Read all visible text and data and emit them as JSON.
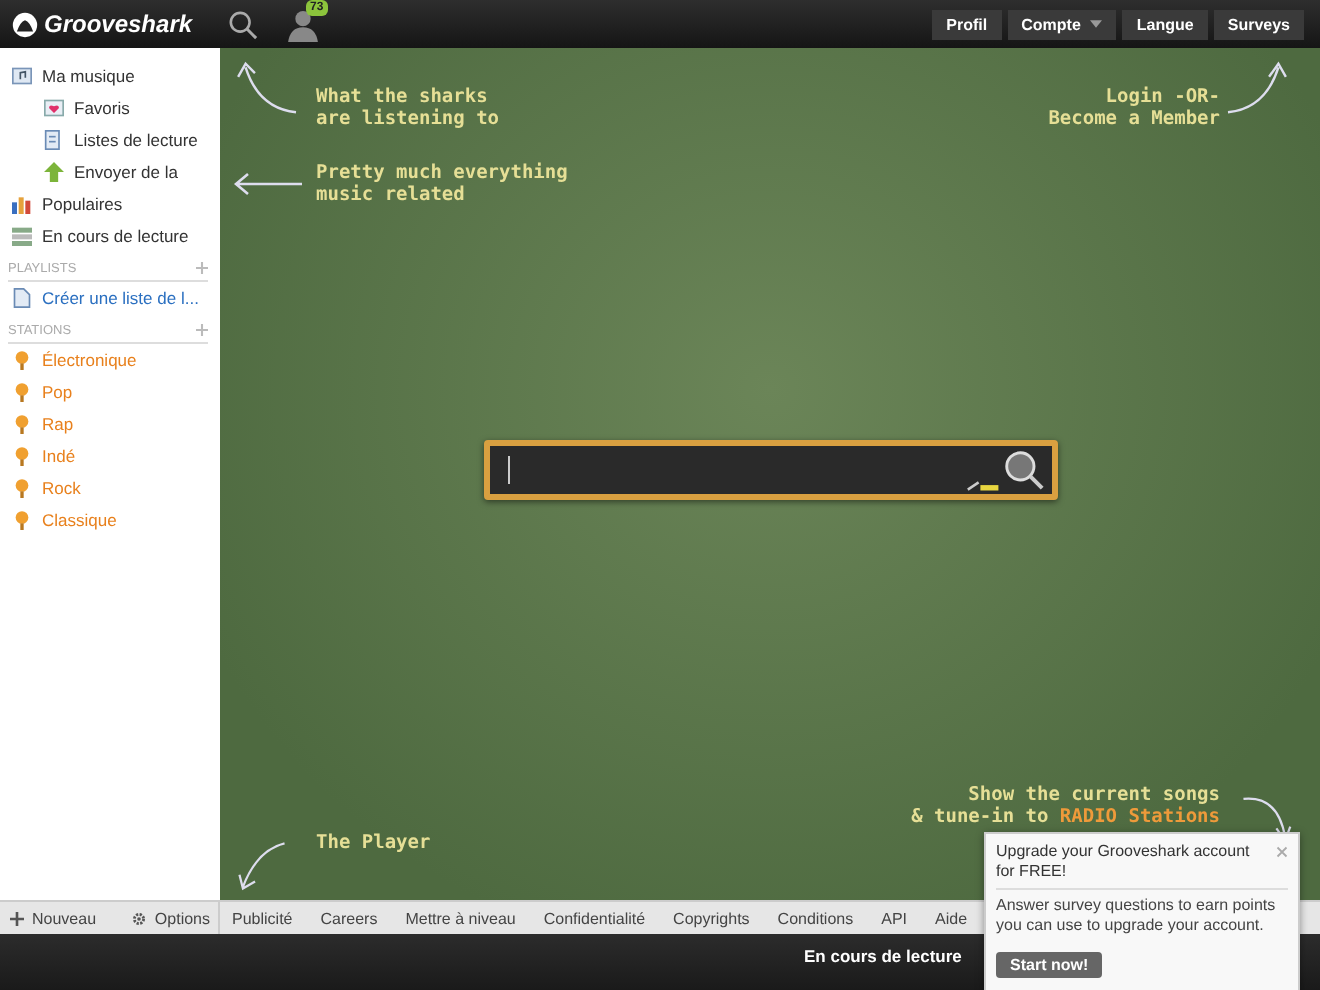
{
  "header": {
    "logo": "Grooveshark",
    "notification_count": "73",
    "nav_buttons": [
      {
        "label": "Profil",
        "dropdown": false
      },
      {
        "label": "Compte",
        "dropdown": true
      },
      {
        "label": "Langue",
        "dropdown": false
      },
      {
        "label": "Surveys",
        "dropdown": false
      }
    ]
  },
  "sidebar": {
    "items": [
      {
        "label": "Ma musique",
        "kind": "music",
        "children": [
          {
            "label": "Favoris",
            "kind": "heart"
          },
          {
            "label": "Listes de lecture",
            "kind": "playlist"
          },
          {
            "label": "Envoyer de la",
            "kind": "upload"
          }
        ]
      },
      {
        "label": "Populaires",
        "kind": "chart"
      },
      {
        "label": "En cours de lecture",
        "kind": "queue"
      }
    ],
    "playlists": {
      "heading": "PLAYLISTS",
      "items": [
        "Créer une liste de l..."
      ]
    },
    "stations": {
      "heading": "STATIONS",
      "items": [
        "Électronique",
        "Pop",
        "Rap",
        "Indé",
        "Rock",
        "Classique"
      ]
    }
  },
  "annotations": [
    {
      "lines": [
        "What the sharks",
        "are listening to"
      ]
    },
    {
      "lines": [
        "Pretty much everything",
        "music related"
      ]
    },
    {
      "lines": [
        "Login -OR-",
        "Become a Member"
      ]
    },
    {
      "lines": [
        "The Player"
      ]
    },
    {
      "lines": [
        "Show the current songs",
        "& tune-in to **RADIO Stations**"
      ]
    }
  ],
  "footer": {
    "actions": [
      {
        "label": "Nouveau",
        "kind": "plus"
      },
      {
        "label": "Options",
        "kind": "gear"
      }
    ],
    "links": [
      "Publicité",
      "Careers",
      "Mettre à niveau",
      "Confidentialité",
      "Copyrights",
      "Conditions",
      "API",
      "Aide"
    ]
  },
  "player": {
    "now_playing": "En cours de lecture"
  },
  "popup": {
    "title": "Upgrade your Grooveshark account for FREE!",
    "message": "Answer survey questions to earn points you can use to upgrade your account.",
    "button": "Start now!"
  }
}
